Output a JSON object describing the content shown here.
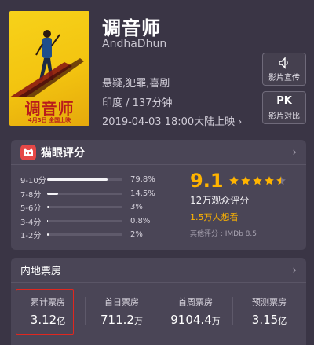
{
  "movie": {
    "title_cn": "调音师",
    "title_en": "AndhaDhun",
    "genre": "悬疑,犯罪,喜剧",
    "region_duration": "印度 / 137分钟",
    "release": "2019-04-03 18:00大陆上映",
    "poster_title": "调音师",
    "poster_date": "4月3日 全国上映"
  },
  "side_buttons": [
    {
      "icon": "promo-video-icon",
      "label": "影片宣传"
    },
    {
      "icon_text": "PK",
      "label": "影片对比"
    }
  ],
  "rating": {
    "header": "猫眼评分",
    "score": "9.1",
    "stars": 4.5,
    "count_text": "12万观众评分",
    "want_text": "1.5万人想看",
    "other_text": "其他评分 : IMDb 8.5",
    "distribution": [
      {
        "label": "9-10分",
        "pct_text": "79.8%",
        "pct": 79.8
      },
      {
        "label": "7-8分",
        "pct_text": "14.5%",
        "pct": 14.5
      },
      {
        "label": "5-6分",
        "pct_text": "3%",
        "pct": 3
      },
      {
        "label": "3-4分",
        "pct_text": "0.8%",
        "pct": 0.8
      },
      {
        "label": "1-2分",
        "pct_text": "2%",
        "pct": 2
      }
    ]
  },
  "box_office": {
    "header": "内地票房",
    "items": [
      {
        "label": "累计票房",
        "value": "3.12",
        "unit": "亿"
      },
      {
        "label": "首日票房",
        "value": "711.2",
        "unit": "万"
      },
      {
        "label": "首周票房",
        "value": "9104.4",
        "unit": "万"
      },
      {
        "label": "预测票房",
        "value": "3.15",
        "unit": "亿"
      }
    ]
  },
  "colors": {
    "accent": "#ffb400",
    "brand": "#e54847",
    "highlight": "#e0271f"
  }
}
